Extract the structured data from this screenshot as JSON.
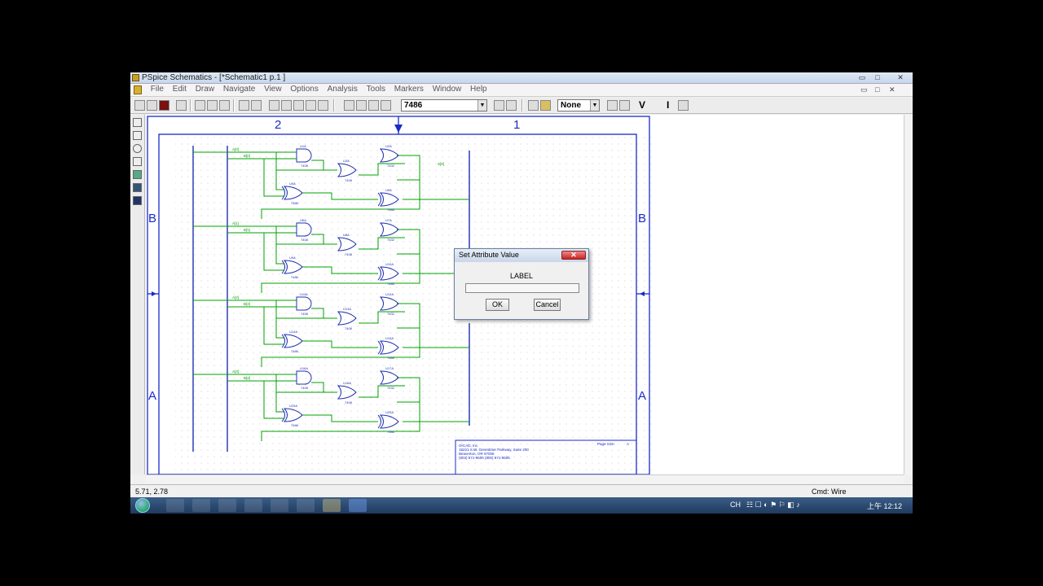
{
  "window": {
    "title": "PSpice Schematics - [*Schematic1  p.1 ]",
    "controls": {
      "minimize": "▭",
      "maximize": "□",
      "close": "✕"
    }
  },
  "menu": {
    "items": [
      "File",
      "Edit",
      "Draw",
      "Navigate",
      "View",
      "Options",
      "Analysis",
      "Tools",
      "Markers",
      "Window",
      "Help"
    ]
  },
  "toolbar": {
    "part_combo": "7486",
    "marker_combo": "None",
    "buttons": [
      "V",
      "I"
    ]
  },
  "schematic": {
    "border_top_labels": [
      "2",
      "1"
    ],
    "border_side_labels": [
      "B",
      "B",
      "A",
      "A"
    ],
    "colors": {
      "border": "#1a2ac8",
      "wire": "#00a000",
      "part": "#2030b0",
      "grid": "#c8c8c8"
    },
    "net_labels": [
      "A[0]",
      "B[0]",
      "A[1]",
      "B[1]",
      "A[2]",
      "B[2]",
      "A[3]",
      "B[3]",
      "S[0]"
    ],
    "part_refs": [
      "U1A",
      "U2A",
      "U3A",
      "U4A",
      "U5A",
      "U6A",
      "U7A",
      "U8A",
      "U9A",
      "U10A",
      "U11A",
      "U12A",
      "U13A",
      "U14A",
      "U15A",
      "U16A",
      "U17A",
      "U18A",
      "U19A",
      "U20A"
    ],
    "part_types": [
      "7408",
      "7432",
      "7486"
    ],
    "title_block": {
      "company": "OrCAD, Inc.",
      "address1": "15221 S.W. Greenbrier Parkway, Suite 200",
      "address2": "Beaverton, OR 97006",
      "phone": "(503) 671-9500   (800) 671-9505",
      "page_size_label": "Page Size:",
      "page_size_value": "A"
    }
  },
  "dialog": {
    "title": "Set Attribute Value",
    "close": "✕",
    "field_label": "LABEL",
    "field_value": "",
    "ok_label": "OK",
    "cancel_label": "Cancel"
  },
  "status": {
    "coordinates": "5.71, 2.78",
    "command": "Cmd: Wire"
  },
  "taskbar": {
    "tray": {
      "lang": "CH",
      "time": "上午 12:12"
    }
  }
}
